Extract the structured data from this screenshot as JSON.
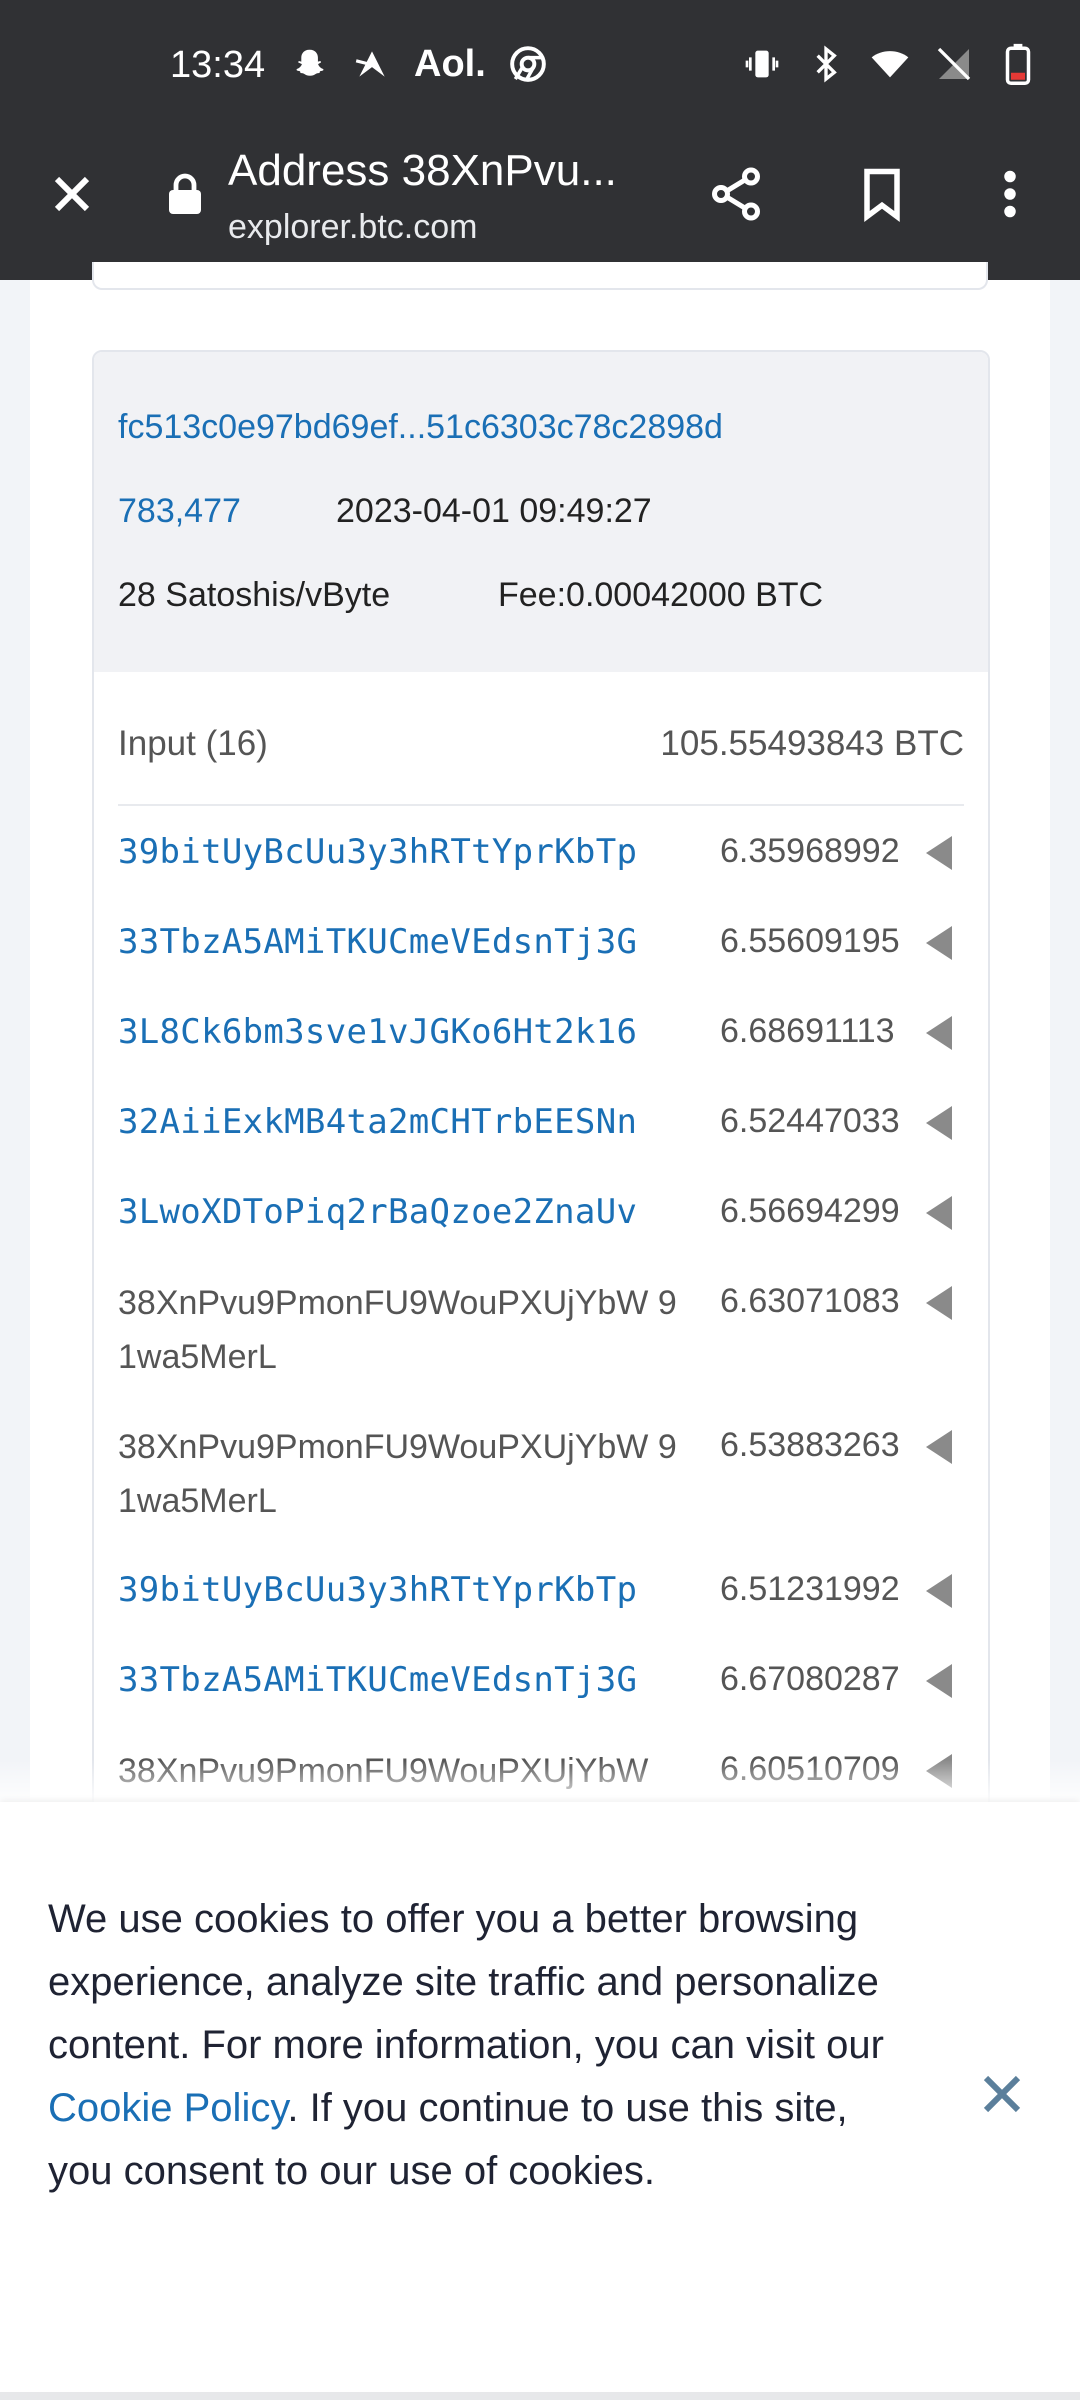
{
  "status_bar": {
    "time": "13:34",
    "left_icons": [
      "snapchat-icon",
      "delivery-icon",
      "aol-icon",
      "chrome-icon"
    ],
    "aol_label": "Aol.",
    "right_icons": [
      "vibrate-icon",
      "bluetooth-icon",
      "wifi-icon",
      "no-signal-icon",
      "battery-icon"
    ]
  },
  "browser": {
    "title": "Address 38XnPvu...",
    "url": "explorer.btc.com"
  },
  "transaction": {
    "hash": "fc513c0e97bd69ef...51c6303c78c2898d",
    "block_height": "783,477",
    "time": "2023-04-01 09:49:27",
    "fee_rate": "28 Satoshis/vByte",
    "fee": "Fee:0.00042000 BTC",
    "input_label": "Input (16)",
    "input_total": "105.55493843 BTC",
    "inputs": [
      {
        "address": "39bitUyBcUu3y3hRTtYprKbTp",
        "amount": "6.35968992"
      },
      {
        "address": "33TbzA5AMiTKUCmeVEdsnTj3G",
        "amount": "6.55609195"
      },
      {
        "address": "3L8Ck6bm3sve1vJGKo6Ht2k16",
        "amount": "6.68691113"
      },
      {
        "address": "32AiiExkMB4ta2mCHTrbEESNn",
        "amount": "6.52447033"
      },
      {
        "address": "3LwoXDToPiq2rBaQzoe2ZnaUv",
        "amount": "6.56694299"
      },
      {
        "address": "38XnPvu9PmonFU9WouPXUjYbW 91wa5MerL",
        "amount": "6.63071083"
      },
      {
        "address": "38XnPvu9PmonFU9WouPXUjYbW 91wa5MerL",
        "amount": "6.53883263"
      },
      {
        "address": "39bitUyBcUu3y3hRTtYprKbTp",
        "amount": "6.51231992"
      },
      {
        "address": "33TbzA5AMiTKUCmeVEdsnTj3G",
        "amount": "6.67080287"
      },
      {
        "address": "38XnPvu9PmonFU9WouPXUjYbW",
        "amount": "6.60510709"
      }
    ]
  },
  "cookie": {
    "text_before": "We use cookies to offer you a better browsing experience, analyze site traffic and personalize content. For more information, you can visit our ",
    "link": "Cookie Policy",
    "text_after": ". If you continue to use this site, you consent to our use of cookies."
  },
  "colors": {
    "link": "#1a6fb5",
    "toolbar": "#303134",
    "cookie_close": "#5b7f9b"
  }
}
